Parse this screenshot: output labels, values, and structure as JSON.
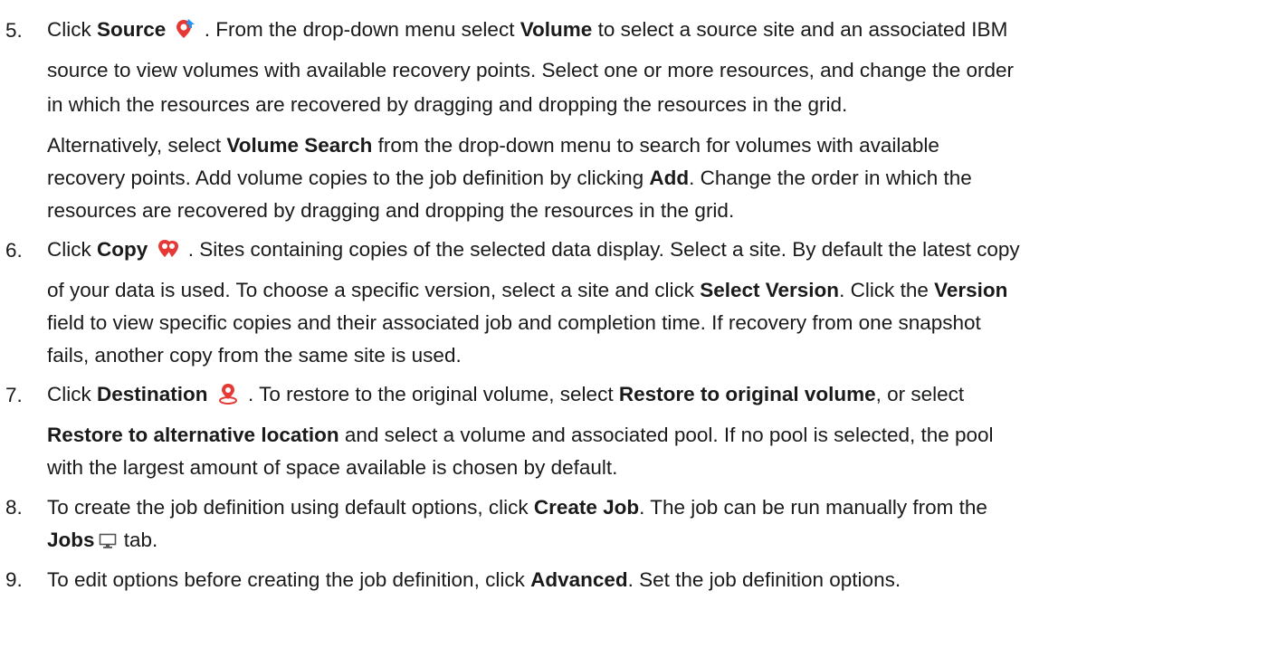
{
  "steps": [
    {
      "number": "5.",
      "lines": [
        [
          "Click ",
          "Source",
          " ",
          "",
          " . From the drop-down menu select ",
          "Volume",
          " to select a source site and an associated IBM"
        ],
        [
          "source to view volumes with available recovery points. Select one or more resources, and change the order"
        ],
        [
          "in which the resources are recovered by dragging and dropping the resources in the grid."
        ],
        [
          "Alternatively, select ",
          "Volume Search",
          " from the drop-down menu to search for volumes with available"
        ],
        [
          "recovery points. Add volume copies to the job definition by clicking ",
          "Add",
          ". Change the order in which the"
        ],
        [
          "resources are recovered by dragging and dropping the resources in the grid."
        ]
      ]
    },
    {
      "number": "6.",
      "lines": [
        [
          "Click ",
          "Copy",
          " ",
          "",
          " . Sites containing copies of the selected data display. Select a site. By default the latest copy"
        ],
        [
          "of your data is used. To choose a specific version, select a site and click ",
          "Select Version",
          ". Click the ",
          "Version"
        ],
        [
          "field to view specific copies and their associated job and completion time. If recovery from one snapshot"
        ],
        [
          "fails, another copy from the same site is used."
        ]
      ]
    },
    {
      "number": "7.",
      "lines": [
        [
          "Click ",
          "Destination",
          " ",
          "",
          " . To restore to the original volume, select ",
          "Restore to original volume",
          ", or select"
        ],
        [
          "Restore to alternative location",
          " and select a volume and associated pool. If no pool is selected, the pool"
        ],
        [
          "with the largest amount of space available is chosen by default."
        ]
      ]
    },
    {
      "number": "8.",
      "lines": [
        [
          "To create the job definition using default options, click ",
          "Create Job",
          ". The job can be run manually from the"
        ],
        [
          "Jobs",
          "",
          " tab."
        ]
      ]
    },
    {
      "number": "9.",
      "lines": [
        [
          "To edit options before creating the job definition, click ",
          "Advanced",
          ". Set the job definition options."
        ]
      ]
    }
  ],
  "icons": {
    "source": "source-site-icon",
    "copy": "copy-site-icon",
    "destination": "destination-site-icon",
    "jobs": "monitor-icon"
  },
  "colors": {
    "text": "#1a1a1a",
    "source_icon": "#e53935",
    "source_icon_accent": "#2196f3",
    "copy_icon": "#e53935",
    "destination_icon": "#e53935",
    "jobs_icon": "#555555"
  }
}
